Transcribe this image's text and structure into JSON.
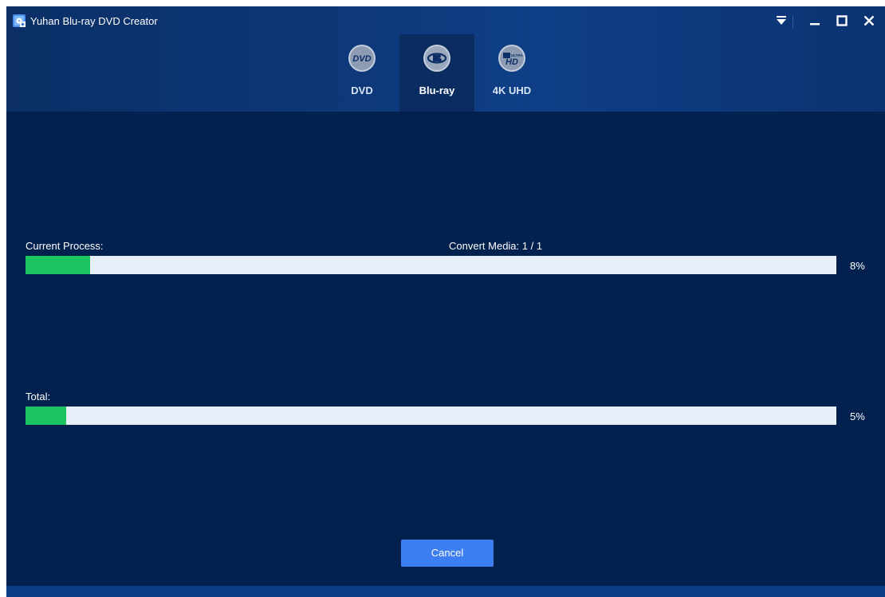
{
  "app": {
    "title": "Yuhan Blu-ray DVD Creator"
  },
  "tabs": [
    {
      "label": "DVD",
      "icon": "dvd-logo-icon",
      "active": false
    },
    {
      "label": "Blu-ray",
      "icon": "bluray-logo-icon",
      "active": true
    },
    {
      "label": "4K UHD",
      "icon": "ultra-hd-logo-icon",
      "active": false
    }
  ],
  "window_controls": [
    {
      "name": "dropdown-menu-icon"
    },
    {
      "name": "minimize-icon"
    },
    {
      "name": "maximize-icon"
    },
    {
      "name": "close-icon"
    }
  ],
  "current": {
    "label": "Current Process:",
    "status": "Convert Media:  1 / 1",
    "percent_text": "8%",
    "progress": 0.08
  },
  "total": {
    "label": "Total:",
    "percent_text": "5%",
    "progress": 0.05
  },
  "cancel_label": "Cancel",
  "colors": {
    "background": "#03214f",
    "header": "#0d3a7c",
    "progress_fill": "#1bc45e",
    "progress_track": "#e6eef8",
    "cancel_button": "#3d7ef2"
  }
}
